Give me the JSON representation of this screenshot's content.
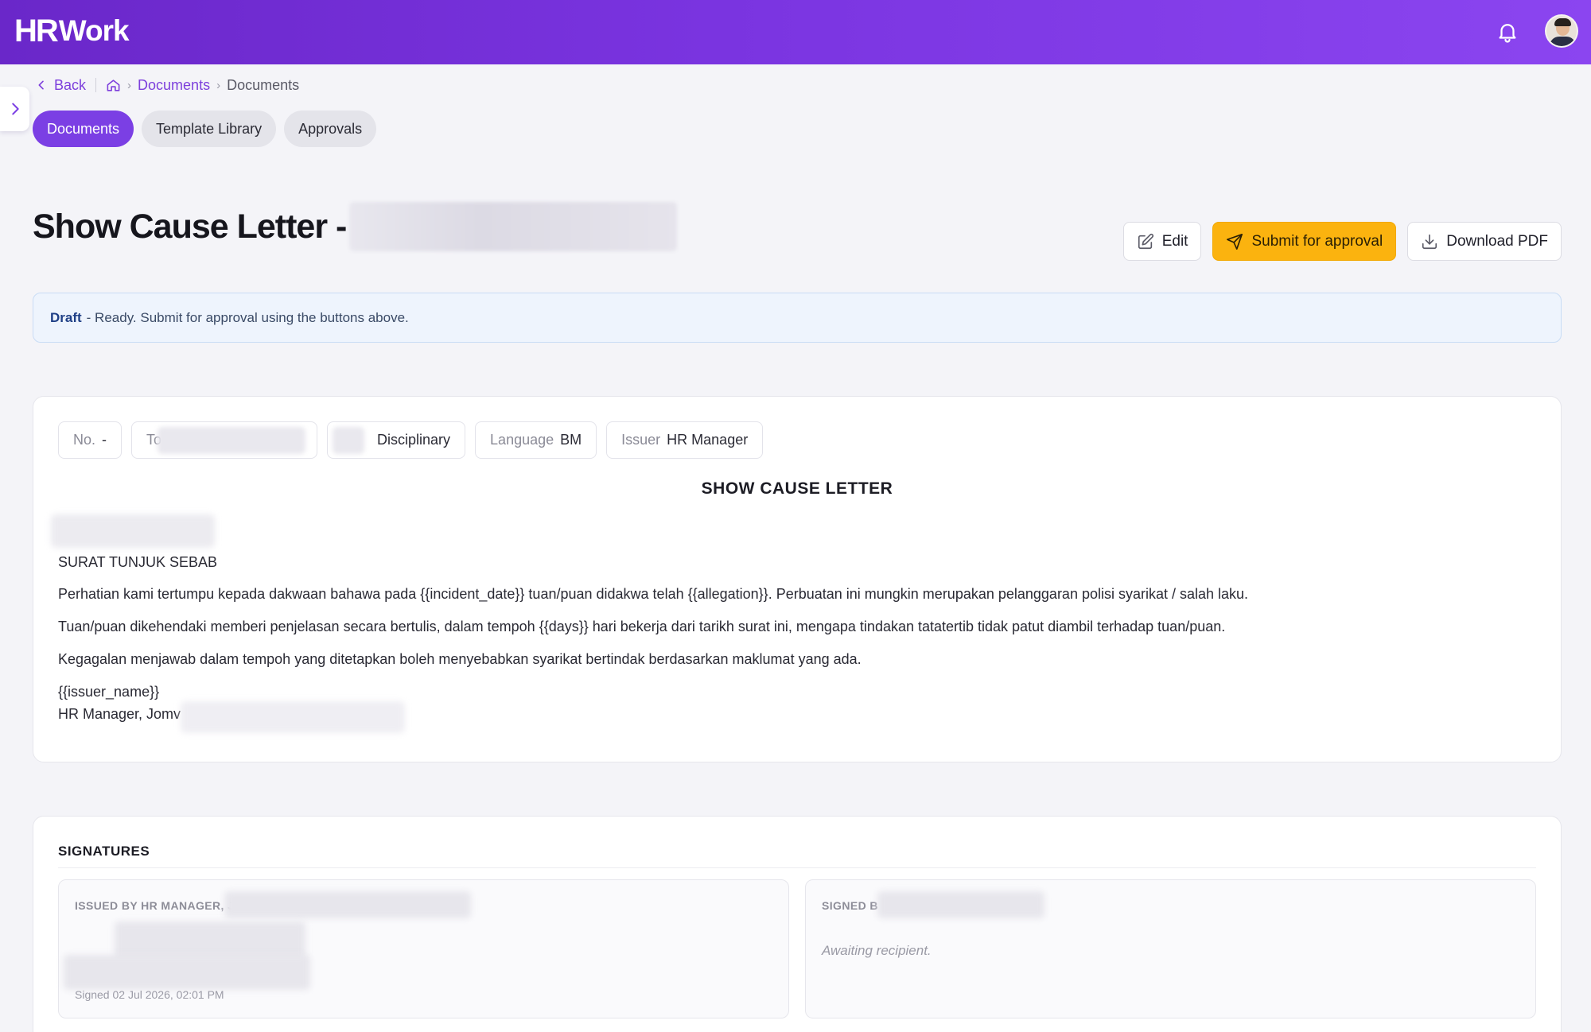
{
  "header": {
    "logo_hr": "HR",
    "logo_work": "Work",
    "bell_icon": "bell-icon",
    "avatar": "user-avatar"
  },
  "breadcrumb": {
    "back": "Back",
    "home_icon": "home-icon",
    "crumb1": "Documents",
    "crumb2": "Documents"
  },
  "tabs": [
    {
      "label": "Documents",
      "active": true
    },
    {
      "label": "Template Library",
      "active": false
    },
    {
      "label": "Approvals",
      "active": false
    }
  ],
  "page": {
    "title": "Show Cause Letter -"
  },
  "actions": {
    "edit": "Edit",
    "submit": "Submit for approval",
    "download": "Download PDF"
  },
  "status": {
    "state": "Draft",
    "message": "- Ready. Submit for approval using the buttons above."
  },
  "document": {
    "chips": {
      "no_label": "No.",
      "no_value": "-",
      "to_label": "To",
      "category": "Disciplinary",
      "language_label": "Language",
      "language_value": "BM",
      "issuer_label": "Issuer",
      "issuer_value": "HR Manager"
    },
    "heading": "SHOW CAUSE LETTER",
    "subject": "SURAT TUNJUK SEBAB",
    "paragraphs": [
      "Perhatian kami tertumpu kepada dakwaan bahawa pada {{incident_date}} tuan/puan didakwa telah {{allegation}}. Perbuatan ini mungkin merupakan pelanggaran polisi syarikat / salah laku.",
      "Tuan/puan dikehendaki memberi penjelasan secara bertulis, dalam tempoh {{days}} hari bekerja dari tarikh surat ini, mengapa tindakan tatatertib tidak patut diambil terhadap tuan/puan.",
      "Kegagalan menjawab dalam tempoh yang ditetapkan boleh menyebabkan syarikat bertindak berdasarkan maklumat yang ada."
    ],
    "issuer_placeholder": "{{issuer_name}}",
    "signoff": "HR Manager, Jomv"
  },
  "signatures": {
    "title": "SIGNATURES",
    "issued_by": "ISSUED BY HR MANAGER, J",
    "signed_at": "Signed 02 Jul 2026, 02:01 PM",
    "signed_by": "SIGNED B",
    "waiting": "Awaiting recipient."
  },
  "colors": {
    "brand_purple": "#7b3fe4",
    "submit_yellow": "#fbb30f",
    "status_bg": "#eef4fd"
  }
}
